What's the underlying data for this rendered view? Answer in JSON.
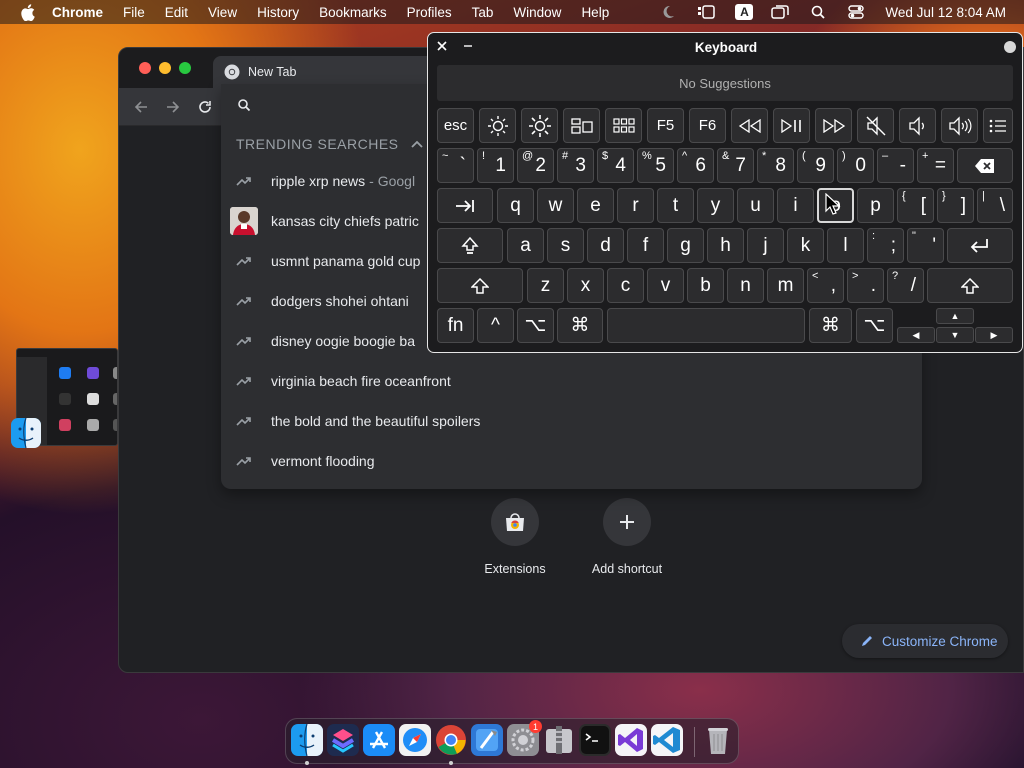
{
  "menubar": {
    "app_name": "Chrome",
    "items": [
      "File",
      "Edit",
      "View",
      "History",
      "Bookmarks",
      "Profiles",
      "Tab",
      "Window",
      "Help"
    ],
    "input_source": "A",
    "clock": "Wed Jul 12  8:04 AM"
  },
  "chrome": {
    "tab_title": "New Tab",
    "trending_header": "TRENDING SEARCHES",
    "suggestions": [
      {
        "text": "ripple xrp news",
        "suffix": "- Googl",
        "icon": "trending-icon"
      },
      {
        "text": "kansas city chiefs patric",
        "suffix": "",
        "icon": "player-thumbnail"
      },
      {
        "text": "usmnt panama gold cup",
        "suffix": "",
        "icon": "trending-icon"
      },
      {
        "text": "dodgers shohei ohtani",
        "suffix": "",
        "icon": "trending-icon"
      },
      {
        "text": "disney oogie boogie ba",
        "suffix": "",
        "icon": "trending-icon"
      },
      {
        "text": "virginia beach fire oceanfront",
        "suffix": "",
        "icon": "trending-icon"
      },
      {
        "text": "the bold and the beautiful spoilers",
        "suffix": "",
        "icon": "trending-icon"
      },
      {
        "text": "vermont flooding",
        "suffix": "",
        "icon": "trending-icon"
      }
    ],
    "shortcuts": [
      {
        "label": "Extensions",
        "icon": "chrome-web-store-icon"
      },
      {
        "label": "Add shortcut",
        "icon": "plus-icon"
      }
    ],
    "customize_label": "Customize Chrome"
  },
  "keyboard": {
    "title": "Keyboard",
    "suggestions_text": "No Suggestions",
    "fn_row": [
      "esc",
      "brightness-down-icon",
      "brightness-up-icon",
      "mission-control-icon",
      "launchpad-icon",
      "F5",
      "F6",
      "rewind-icon",
      "play-pause-icon",
      "fast-forward-icon",
      "mute-icon",
      "volume-down-icon",
      "volume-up-icon",
      "list-icon"
    ],
    "f5": "F5",
    "f6": "F6",
    "esc": "esc",
    "number_row": [
      {
        "shift": "~",
        "main": "`"
      },
      {
        "shift": "!",
        "main": "1"
      },
      {
        "shift": "@",
        "main": "2"
      },
      {
        "shift": "#",
        "main": "3"
      },
      {
        "shift": "$",
        "main": "4"
      },
      {
        "shift": "%",
        "main": "5"
      },
      {
        "shift": "^",
        "main": "6"
      },
      {
        "shift": "&",
        "main": "7"
      },
      {
        "shift": "*",
        "main": "8"
      },
      {
        "shift": "(",
        "main": "9"
      },
      {
        "shift": ")",
        "main": "0"
      },
      {
        "shift": "–",
        "main": "-"
      },
      {
        "shift": "+",
        "main": "="
      }
    ],
    "qwerty_row": [
      "q",
      "w",
      "e",
      "r",
      "t",
      "y",
      "u",
      "i",
      "o",
      "p"
    ],
    "qwerty_brackets": [
      {
        "shift": "{",
        "main": "["
      },
      {
        "shift": "}",
        "main": "]"
      },
      {
        "shift": "|",
        "main": "\\"
      }
    ],
    "home_row": [
      "a",
      "s",
      "d",
      "f",
      "g",
      "h",
      "j",
      "k",
      "l"
    ],
    "home_punct": [
      {
        "shift": ":",
        "main": ";"
      },
      {
        "shift": "\"",
        "main": "'"
      }
    ],
    "bottom_row": [
      "z",
      "x",
      "c",
      "v",
      "b",
      "n",
      "m"
    ],
    "bottom_punct": [
      {
        "shift": "<",
        "main": ","
      },
      {
        "shift": ">",
        "main": "."
      },
      {
        "shift": "?",
        "main": "/"
      }
    ],
    "modifiers": {
      "fn": "fn",
      "control": "^",
      "option": "⌥",
      "command": "⌘"
    },
    "arrows": {
      "up": "▲",
      "left": "◀",
      "down": "▼",
      "right": "▶"
    }
  },
  "dock": {
    "apps": [
      "Finder",
      "Shortcuts",
      "App Store",
      "Safari",
      "Google Chrome",
      "Xcode",
      "System Settings",
      "Archive Utility",
      "Terminal",
      "Visual Studio",
      "Visual Studio Code",
      "Trash"
    ],
    "settings_badge": "1"
  }
}
